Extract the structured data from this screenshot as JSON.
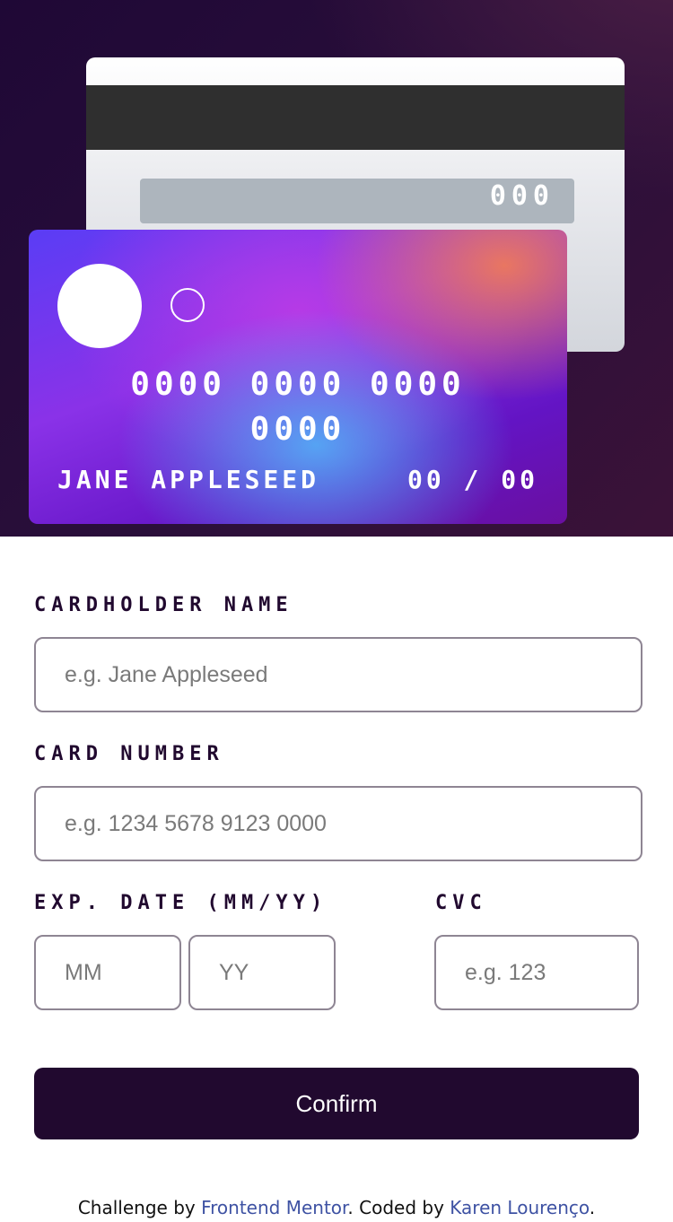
{
  "card_back": {
    "cvc": "000"
  },
  "card_front": {
    "number": "0000 0000 0000 0000",
    "name": "JANE APPLESEED",
    "expiry": "00 / 00"
  },
  "form": {
    "cardholder_label": "CARDHOLDER NAME",
    "cardholder_placeholder": "e.g. Jane Appleseed",
    "number_label": "CARD NUMBER",
    "number_placeholder": "e.g. 1234 5678 9123 0000",
    "exp_label": "EXP. DATE (MM/YY)",
    "month_placeholder": "MM",
    "year_placeholder": "YY",
    "cvc_label": "CVC",
    "cvc_placeholder": "e.g. 123",
    "confirm_label": "Confirm"
  },
  "footer": {
    "prefix": "Challenge by ",
    "mentor_link": "Frontend Mentor",
    "middle": ". Coded by ",
    "author_link": "Karen Lourenço",
    "suffix": "."
  },
  "colors": {
    "primary_dark": "#21092f",
    "link": "#3e52a3",
    "input_border": "#8e8593"
  }
}
